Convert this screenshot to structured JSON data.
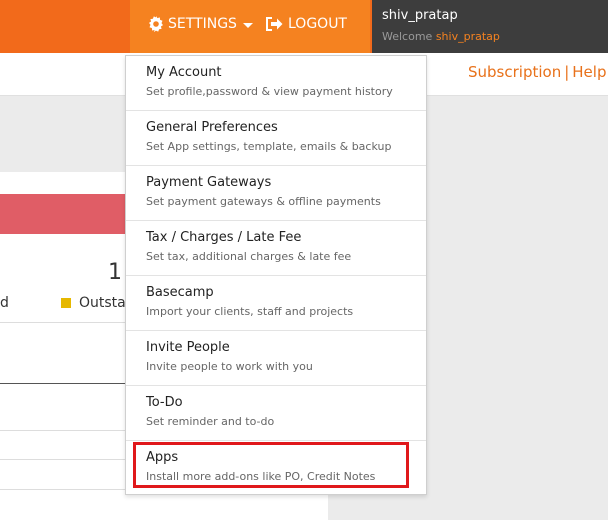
{
  "header": {
    "settings_label": "SETTINGS",
    "logout_label": "LOGOUT",
    "username": "shiv_pratap",
    "welcome_prefix": "Welcome",
    "welcome_username": "shiv_pratap"
  },
  "subnav": {
    "subscription_label": "Subscription",
    "separator": "|",
    "help_label": "Help"
  },
  "background": {
    "number": "1",
    "legend_left": "d",
    "legend_outstanding": "Outsta"
  },
  "menu": {
    "items": [
      {
        "title": "My Account",
        "desc": "Set profile,password & view payment history"
      },
      {
        "title": "General Preferences",
        "desc": "Set App settings, template, emails & backup"
      },
      {
        "title": "Payment Gateways",
        "desc": "Set payment gateways & offline payments"
      },
      {
        "title": "Tax / Charges / Late Fee",
        "desc": "Set tax, additional charges & late fee"
      },
      {
        "title": "Basecamp",
        "desc": "Import your clients, staff and projects"
      },
      {
        "title": "Invite People",
        "desc": "Invite people to work with you"
      },
      {
        "title": "To-Do",
        "desc": "Set reminder and to-do"
      },
      {
        "title": "Apps",
        "desc": "Install more add-ons like PO, Credit Notes"
      }
    ]
  },
  "colors": {
    "topbar": "#f26a1b",
    "accent": "#f58220",
    "user_panel": "#3d3d3d",
    "highlight": "#e0181b"
  }
}
